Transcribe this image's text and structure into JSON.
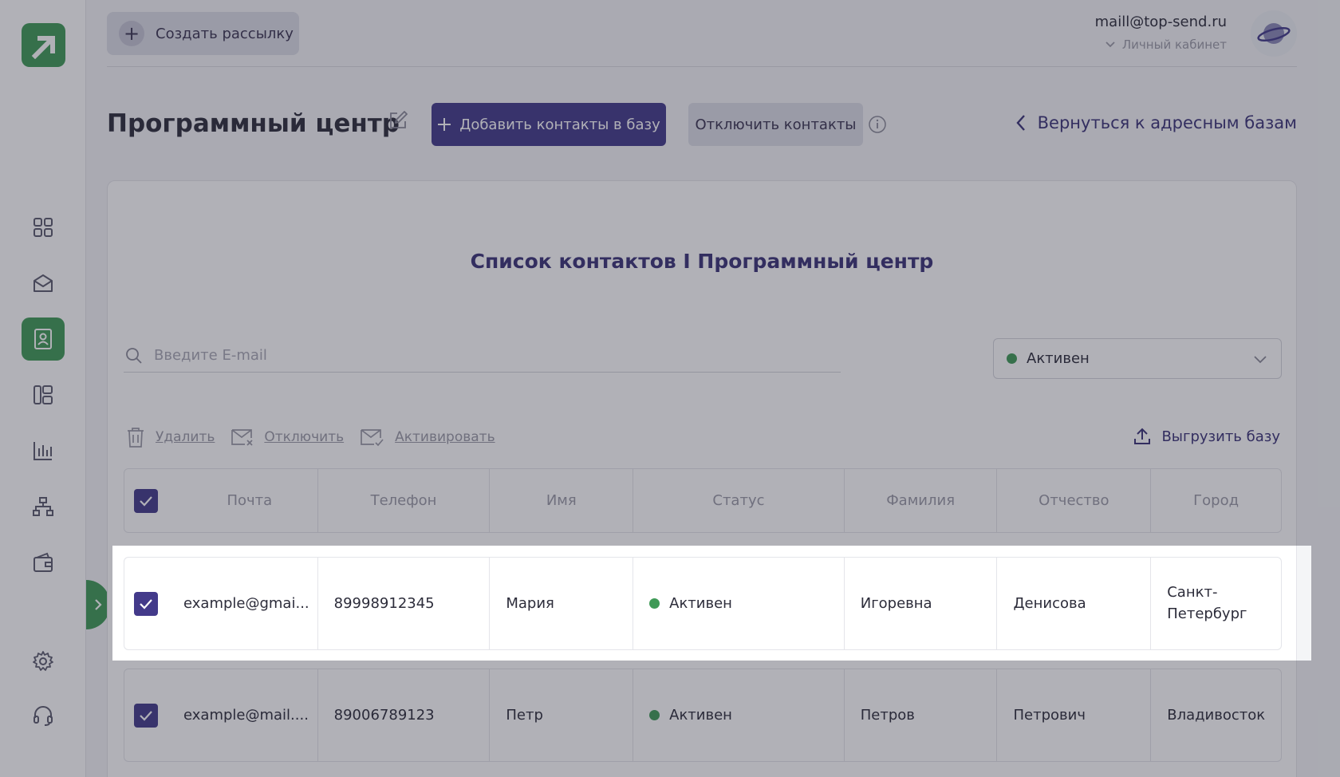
{
  "topbar": {
    "create_label": "Создать рассылку",
    "email": "maill@top-send.ru",
    "cabinet_label": "Личный кабинет"
  },
  "header": {
    "title": "Программный центр",
    "add_contacts_label": "Добавить контакты в базу",
    "disable_contacts_label": "Отключить контакты",
    "back_label": "Вернуться к адресным базам"
  },
  "sidebar": {
    "items": [
      {
        "icon": "dashboard-icon"
      },
      {
        "icon": "mail-campaigns-icon"
      },
      {
        "icon": "contacts-icon",
        "active": true
      },
      {
        "icon": "templates-icon"
      },
      {
        "icon": "statistics-icon"
      },
      {
        "icon": "structure-icon"
      },
      {
        "icon": "wallet-icon"
      },
      {
        "icon": "settings-icon"
      },
      {
        "icon": "support-icon"
      }
    ]
  },
  "card": {
    "title": "Список контактов I Программный центр",
    "search_placeholder": "Введите E-mail",
    "status_filter": "Активен",
    "actions": {
      "delete": "Удалить",
      "disable": "Отключить",
      "activate": "Активировать",
      "export": "Выгрузить базу"
    }
  },
  "table": {
    "columns": [
      "Почта",
      "Телефон",
      "Имя",
      "Статус",
      "Фамилия",
      "Отчество",
      "Город"
    ],
    "rows": [
      {
        "checked": true,
        "email": "example@gmai...",
        "phone": "89998912345",
        "name": "Мария",
        "status": "Активен",
        "surname": "Игоревна",
        "patronymic": "Денисова",
        "city": "Санкт-Петербург"
      },
      {
        "checked": true,
        "email": "example@mail....",
        "phone": "89006789123",
        "name": "Петр",
        "status": "Активен",
        "surname": "Петров",
        "patronymic": "Петрович",
        "city": "Владивосток"
      }
    ]
  },
  "colors": {
    "brand_green": "#3f9a57",
    "primary_purple": "#433a8a",
    "status_active": "#3f9a57"
  }
}
